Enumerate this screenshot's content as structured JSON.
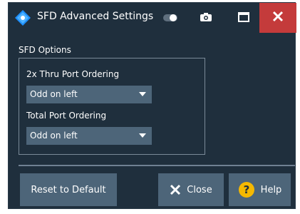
{
  "window": {
    "title": "SFD Advanced Settings",
    "icons": [
      "app-logo-icon",
      "toggle-icon",
      "camera-icon",
      "maximize-icon",
      "close-icon"
    ],
    "close_button_color": "#c43b3b"
  },
  "options": {
    "group_title": "SFD Options",
    "thru_port_ordering": {
      "label": "2x Thru Port Ordering",
      "value": "Odd on left"
    },
    "total_port_ordering": {
      "label": "Total Port Ordering",
      "value": "Odd on left"
    }
  },
  "buttons": {
    "reset_label": "Reset to Default",
    "close_label": "Close",
    "help_label": "Help"
  },
  "colors": {
    "background": "#1f2f3d",
    "control": "#4d6579",
    "help_accent": "#f5b800"
  }
}
